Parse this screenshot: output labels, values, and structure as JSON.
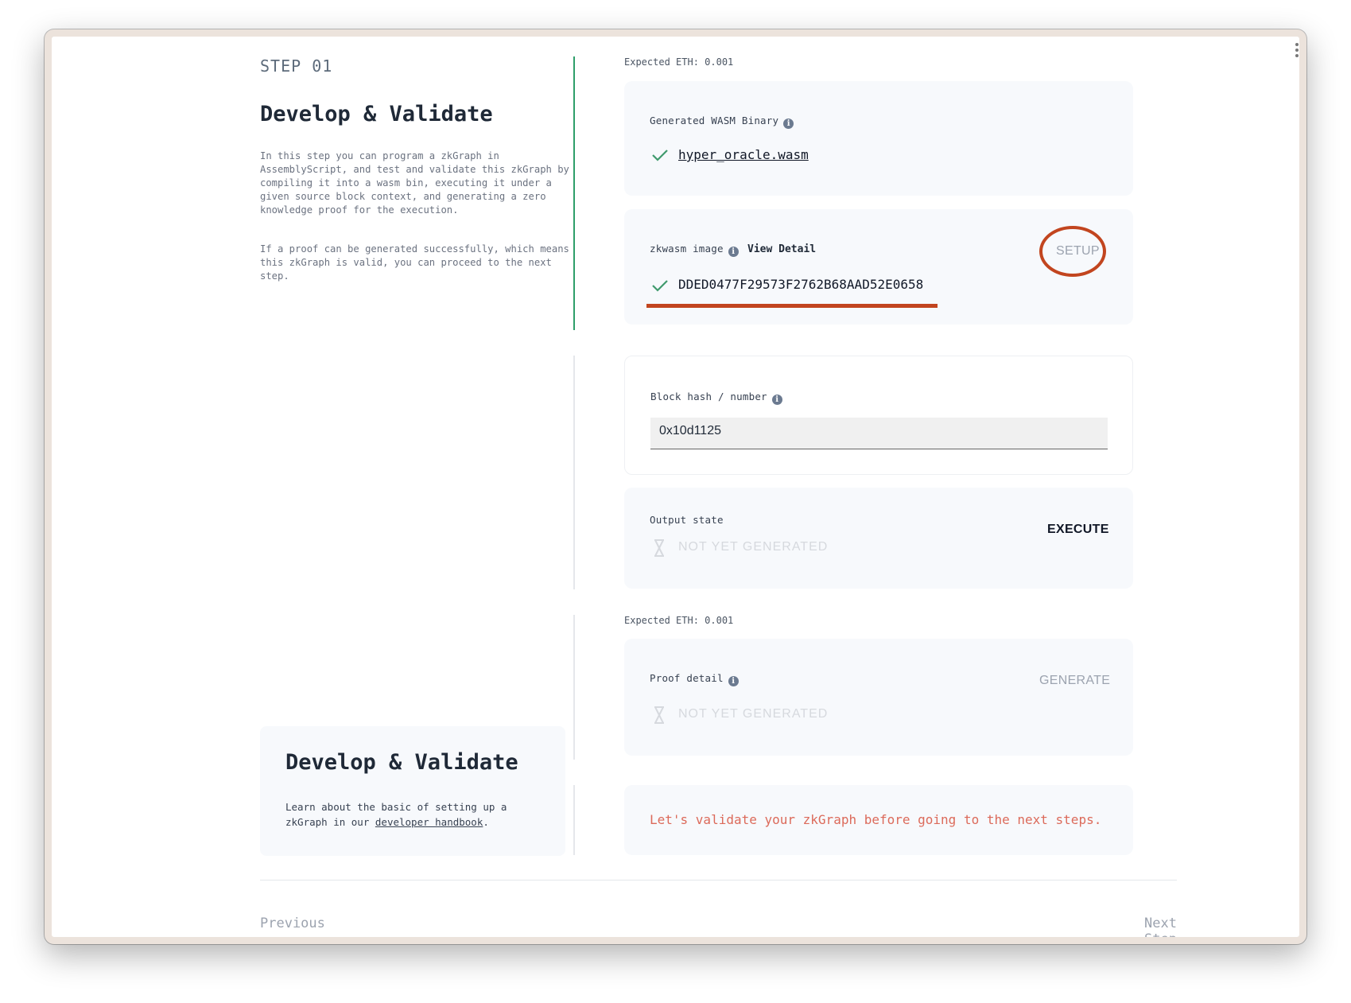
{
  "left": {
    "step_label": "STEP 01",
    "title": "Develop & Validate",
    "paragraph1": "In this step you can program a zkGraph in AssemblyScript, and test and validate this zkGraph by compiling it into a wasm bin, executing it under a given source block context, and generating a zero knowledge proof for the execution.",
    "paragraph2": "If a proof can be generated successfully, which means this zkGraph is valid, you can proceed to the next step."
  },
  "promo": {
    "title": "Develop & Validate",
    "text_before": "Learn about the basic of setting up a zkGraph in our ",
    "link": "developer handbook",
    "text_after": "."
  },
  "compile": {
    "expected_eth": "Expected ETH: 0.001",
    "wasm_label": "Generated WASM Binary",
    "wasm_value": "hyper_oracle.wasm",
    "image_label": "zkwasm image",
    "view_detail": "View Detail",
    "image_value": "DDED0477F29573F2762B68AAD52E0658",
    "setup_button": "SETUP"
  },
  "execute": {
    "block_label": "Block hash / number",
    "block_value": "0x10d1125",
    "output_label": "Output state",
    "output_value": "NOT YET GENERATED",
    "execute_button": "EXECUTE"
  },
  "prove": {
    "expected_eth": "Expected ETH: 0.001",
    "proof_label": "Proof detail",
    "proof_value": "NOT YET GENERATED",
    "generate_button": "GENERATE"
  },
  "validation_message": "Let's validate your zkGraph before going to the next steps.",
  "footer": {
    "previous": "Previous",
    "next": "Next Step"
  },
  "colors": {
    "active_line": "#2e9e6a",
    "check": "#3f9a6d",
    "annotation": "#c2451f",
    "warning_text": "#dc6a5a"
  }
}
